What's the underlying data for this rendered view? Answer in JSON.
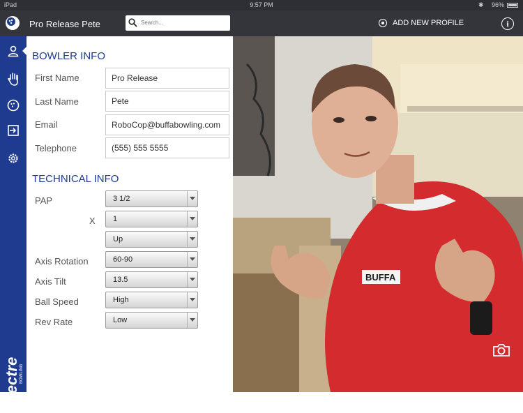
{
  "status_bar": {
    "carrier": "iPad",
    "time": "9:57 PM",
    "battery": "96%"
  },
  "header": {
    "title": "Pro Release Pete",
    "search_placeholder": "Search...",
    "add_profile_label": "ADD NEW PROFILE",
    "info_label": "i"
  },
  "sidebar": {
    "items": [
      "person-icon",
      "hand-icon",
      "bowling-ball-icon",
      "export-icon",
      "gear-icon"
    ],
    "brand_text": "spectre",
    "brand_sub": "BOWLING"
  },
  "bowler_info": {
    "heading": "BOWLER INFO",
    "fields": [
      {
        "label": "First Name",
        "value": "Pro Release"
      },
      {
        "label": "Last Name",
        "value": "Pete"
      },
      {
        "label": "Email",
        "value": "RoboCop@buffabowling.com"
      },
      {
        "label": "Telephone",
        "value": "(555) 555 5555"
      }
    ]
  },
  "technical_info": {
    "heading": "TECHNICAL INFO",
    "pap_label": "PAP",
    "pap_value": "3 1/2",
    "x_label": "X",
    "x_value": "1",
    "direction_value": "Up",
    "axis_rotation": {
      "label": "Axis Rotation",
      "value": "60-90"
    },
    "axis_tilt": {
      "label": "Axis Tilt",
      "value": "13.5"
    },
    "ball_speed": {
      "label": "Ball Speed",
      "value": "High"
    },
    "rev_rate": {
      "label": "Rev Rate",
      "value": "Low"
    }
  },
  "photo": {
    "shirt_text": "BUFFA",
    "camera_icon": "camera-icon"
  },
  "colors": {
    "sidebar": "#1f3b8f",
    "topbar": "#34353b",
    "accent": "#1f3b8f"
  }
}
